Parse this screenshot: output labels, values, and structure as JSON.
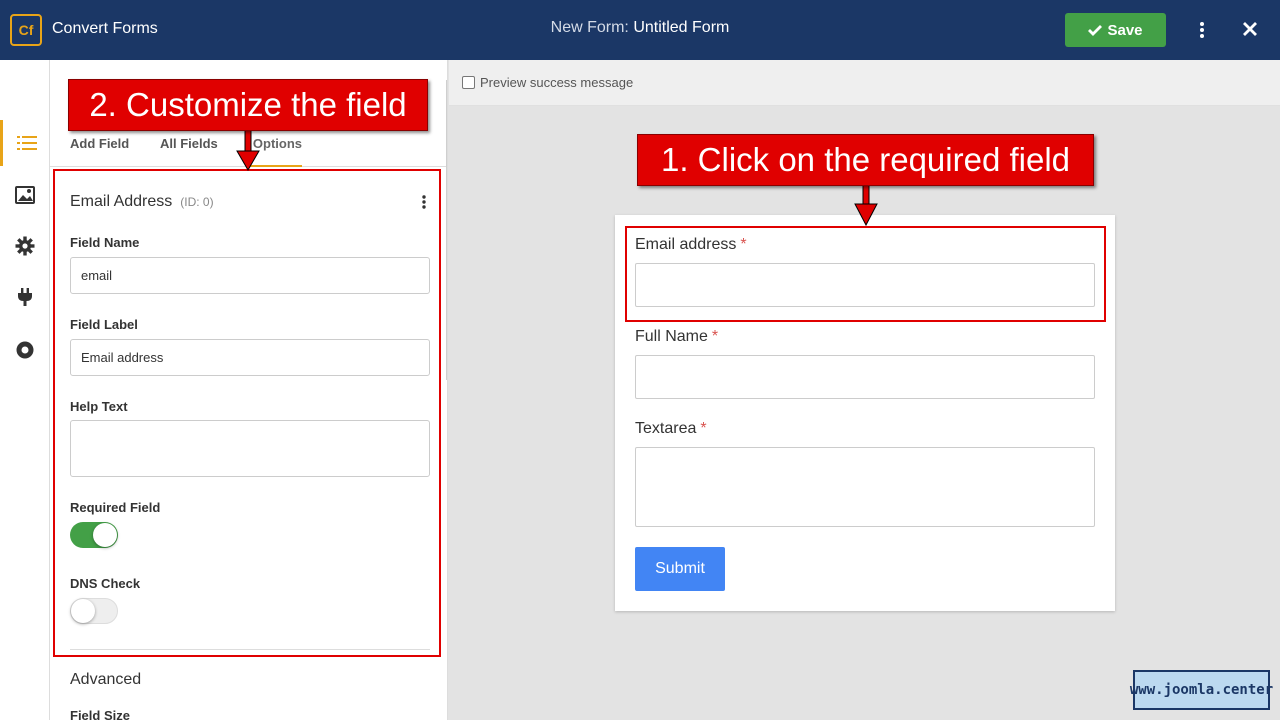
{
  "app": {
    "logo_text": "Cf",
    "name": "Convert Forms"
  },
  "header": {
    "title_prefix": "New Form:",
    "title_name": "Untitled Form",
    "save_label": "Save"
  },
  "sidebar": {
    "tabs": [
      {
        "label": "Add Field"
      },
      {
        "label": "All Fields"
      },
      {
        "label": "Options"
      }
    ],
    "field": {
      "title": "Email Address",
      "id_text": "(ID: 0)",
      "field_name_label": "Field Name",
      "field_name_value": "email",
      "field_label_label": "Field Label",
      "field_label_value": "Email address",
      "help_text_label": "Help Text",
      "required_label": "Required Field",
      "required_on": true,
      "dns_label": "DNS Check",
      "dns_on": false
    },
    "advanced_label": "Advanced",
    "field_size_label": "Field Size"
  },
  "preview": {
    "success_toggle_label": "Preview success message",
    "fields": [
      {
        "label": "Email address",
        "required_mark": "*"
      },
      {
        "label": "Full Name",
        "required_mark": "*"
      },
      {
        "label": "Textarea",
        "required_mark": "*"
      }
    ],
    "submit_label": "Submit"
  },
  "annotations": {
    "step1": "1. Click on the required field",
    "step2": "2. Customize the field"
  },
  "watermark": "www.joomla.center",
  "colors": {
    "header_bg": "#1b3766",
    "accent": "#e8a418",
    "save_green": "#43a047",
    "submit_blue": "#4285f4",
    "annotation_red": "#e00000"
  }
}
